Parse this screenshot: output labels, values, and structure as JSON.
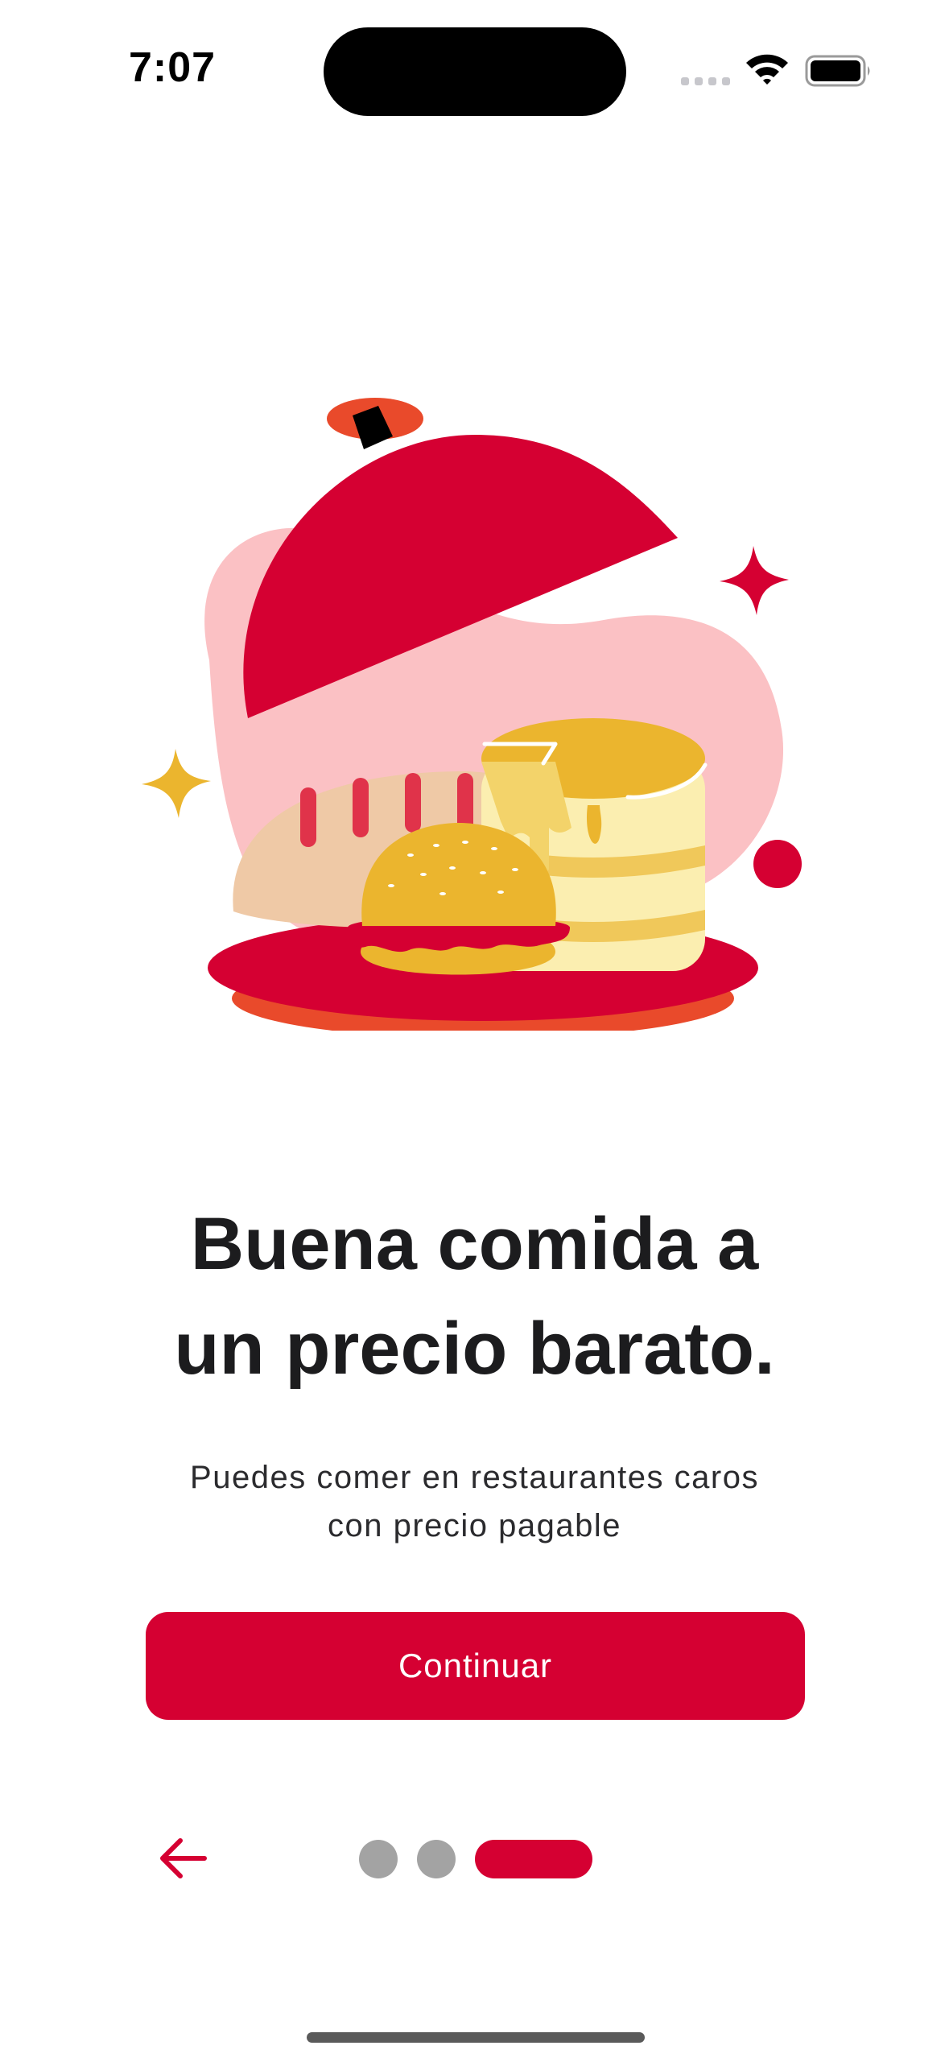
{
  "status_bar": {
    "time": "7:07"
  },
  "onboarding": {
    "title_line1": "Buena comida a",
    "title_line2": "un precio barato.",
    "subtitle_line1": "Puedes comer en restaurantes caros",
    "subtitle_line2": "con precio pagable",
    "continue_label": "Continuar"
  },
  "pagination": {
    "total": 3,
    "current": 3
  },
  "colors": {
    "primary": "#d50032",
    "inactive_dot": "#a3a3a3",
    "blob": "#fbc1c4",
    "mustard": "#ebb52e",
    "title_text": "#1c1c1e"
  },
  "icons": {
    "back": "arrow-left-icon",
    "signal": "cellular-signal-icon",
    "wifi": "wifi-icon",
    "battery": "battery-icon"
  }
}
